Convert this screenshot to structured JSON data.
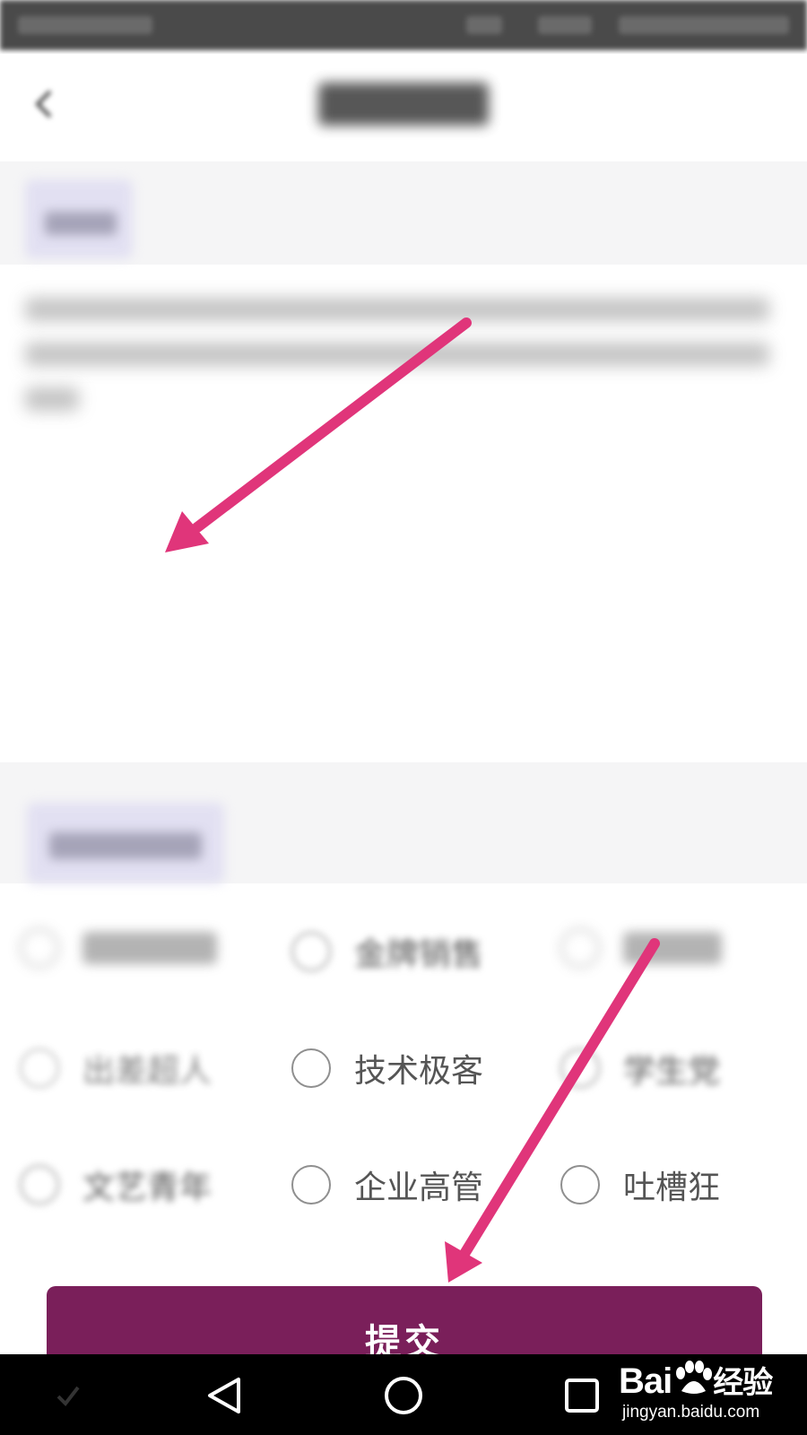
{
  "accent_color": "#7a1f5a",
  "annotation_color": "#e0357a",
  "header": {
    "back_icon": "chevron-left-icon"
  },
  "options": [
    {
      "label": "金牌销售",
      "checked": false
    },
    {
      "label": "出差超人",
      "checked": false
    },
    {
      "label": "技术极客",
      "checked": false
    },
    {
      "label": "学生党",
      "checked": false
    },
    {
      "label": "文艺青年",
      "checked": false
    },
    {
      "label": "企业高管",
      "checked": false
    },
    {
      "label": "吐槽狂",
      "checked": false
    }
  ],
  "submit_label": "提交",
  "nav": {
    "back": "triangle-back-icon",
    "home": "circle-home-icon",
    "recents": "square-recents-icon"
  },
  "watermark": {
    "brand_latin": "Bai",
    "brand_cn": "经验",
    "url": "jingyan.baidu.com"
  }
}
